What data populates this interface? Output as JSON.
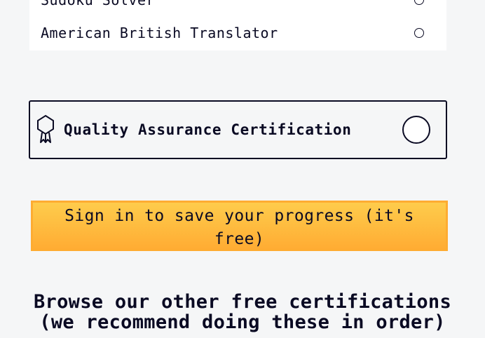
{
  "projects": [
    {
      "label": "Sudoku Solver"
    },
    {
      "label": "American British Translator"
    }
  ],
  "certification": {
    "title": "Quality Assurance Certification",
    "icon": "certificate-ribbon-icon"
  },
  "signin_button": {
    "label": "Sign in to save your progress (it's free)",
    "colors": {
      "top": "#fecc4c",
      "bottom": "#ffac33",
      "border": "#feac32"
    }
  },
  "browse": {
    "heading": "Browse our other free certifications (we recommend doing these in order)"
  },
  "colors": {
    "background": "#f5f6f7",
    "text": "#0a0a23"
  }
}
